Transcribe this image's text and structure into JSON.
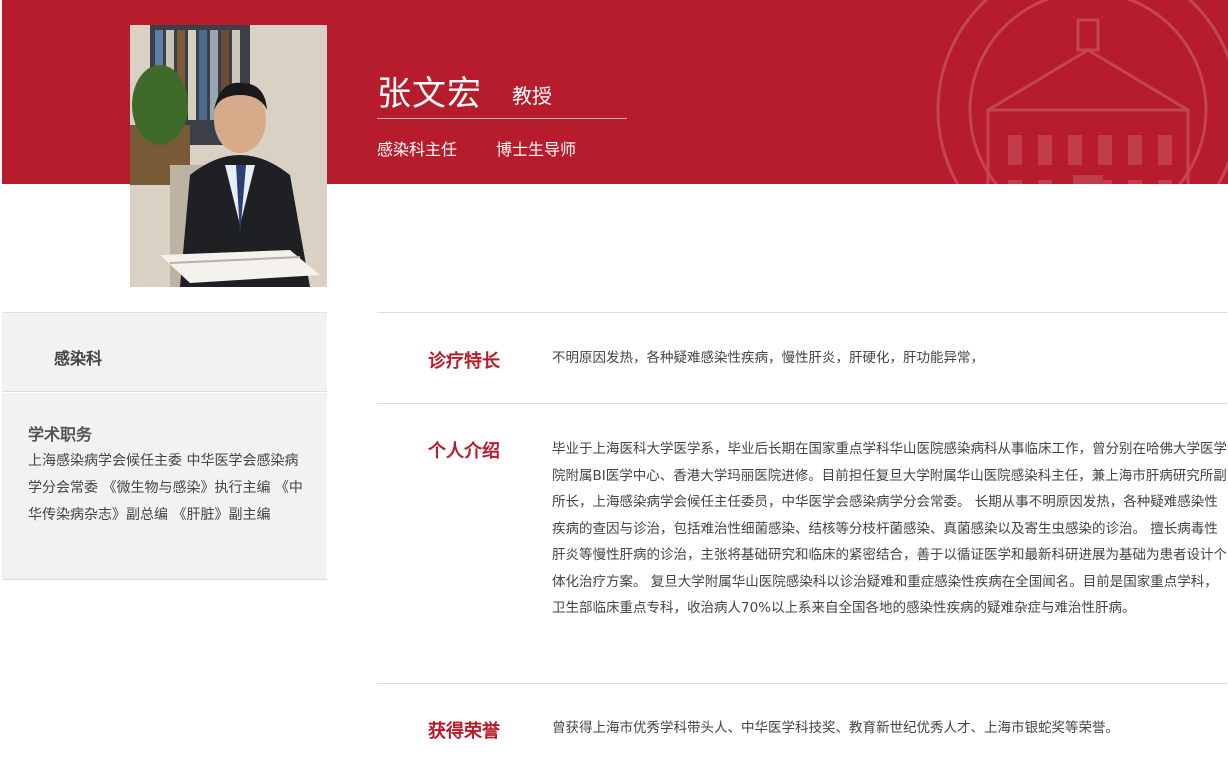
{
  "doctor": {
    "name": "张文宏",
    "title": "教授",
    "role_1": "感染科主任",
    "role_2": "博士生导师"
  },
  "sidebar": {
    "department": "感染科",
    "duties_heading": "学术职务",
    "duties_text": "上海感染病学会候任主委  中华医学会感染病学分会常委  《微生物与感染》执行主编  《中华传染病杂志》副总编  《肝脏》副主编"
  },
  "sections": {
    "specialty": {
      "label": "诊疗特长",
      "text": "不明原因发热，各种疑难感染性疾病，慢性肝炎，肝硬化，肝功能异常，"
    },
    "intro": {
      "label": "个人介绍",
      "text": "毕业于上海医科大学医学系，毕业后长期在国家重点学科华山医院感染病科从事临床工作，曾分别在哈佛大学医学院附属BI医学中心、香港大学玛丽医院进修。目前担任复旦大学附属华山医院感染科主任，兼上海市肝病研究所副所长，上海感染病学会候任主任委员，中华医学会感染病学分会常委。 长期从事不明原因发热，各种疑难感染性疾病的查因与诊治，包括难治性细菌感染、结核等分枝杆菌感染、真菌感染以及寄生虫感染的诊治。 擅长病毒性肝炎等慢性肝病的诊治，主张将基础研究和临床的紧密结合，善于以循证医学和最新科研进展为基础为患者设计个体化治疗方案。 复旦大学附属华山医院感染科以诊治疑难和重症感染性疾病在全国闻名。目前是国家重点学科，卫生部临床重点专科，收治病人70%以上系来自全国各地的感染性疾病的疑难杂症与难治性肝病。"
    },
    "honors": {
      "label": "获得荣誉",
      "text": "曾获得上海市优秀学科带头人、中华医学科技奖、教育新世纪优秀人才、上海市银蛇奖等荣誉。"
    }
  },
  "colors": {
    "brand_red": "#b61c2b",
    "panel_gray": "#f2f2f2"
  }
}
